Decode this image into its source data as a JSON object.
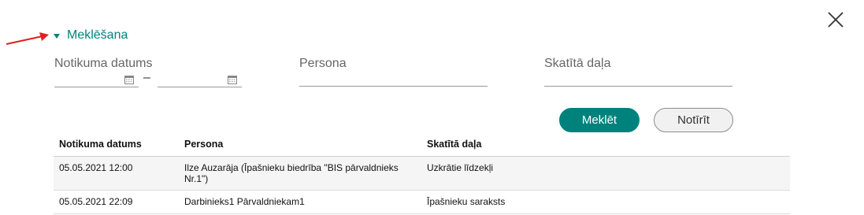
{
  "search_toggle": {
    "label": "Meklēšana"
  },
  "filters": {
    "event_date": {
      "label": "Notikuma datums",
      "from_value": "",
      "to_value": "",
      "separator": "–"
    },
    "person": {
      "label": "Persona",
      "value": ""
    },
    "section": {
      "label": "Skatītā daļa",
      "value": ""
    }
  },
  "actions": {
    "search_label": "Meklēt",
    "clear_label": "Notīrīt"
  },
  "table": {
    "columns": [
      "Notikuma datums",
      "Persona",
      "Skatītā daļa"
    ],
    "rows": [
      [
        "05.05.2021 12:00",
        "Ilze Auzarāja (Īpašnieku biedrība \"BIS pārvaldnieks Nr.1\")",
        "Uzkrātie līdzekļi"
      ],
      [
        "05.05.2021 22:09",
        "Darbinieks1 Pārvaldniekam1",
        "Īpašnieku saraksts"
      ]
    ]
  },
  "colors": {
    "accent": "#00827c",
    "annotation_arrow": "#e02020"
  },
  "icons": {
    "close": "close-icon",
    "calendar": "calendar-icon",
    "toggle": "caret-down-icon"
  }
}
